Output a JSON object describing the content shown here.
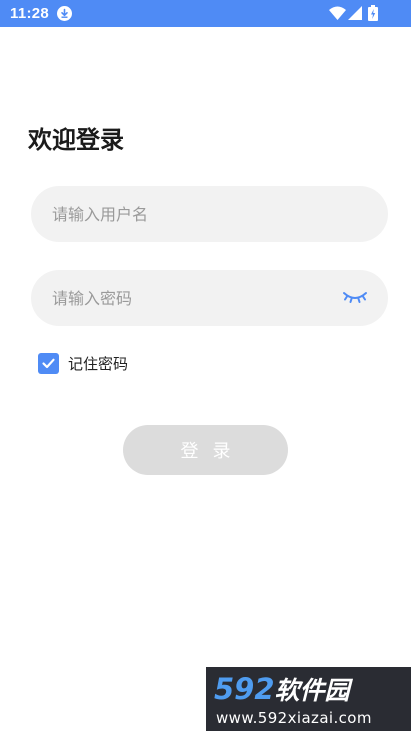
{
  "status_bar": {
    "time": "11:28",
    "background": "#4f8bf5",
    "icons": [
      "download-icon",
      "wifi-icon",
      "signal-icon",
      "battery-icon"
    ]
  },
  "title": "欢迎登录",
  "username": {
    "placeholder": "请输入用户名",
    "value": ""
  },
  "password": {
    "placeholder": "请输入密码",
    "value": "",
    "toggle_icon": "eye-closed-icon"
  },
  "remember": {
    "label": "记住密码",
    "checked": true
  },
  "login_button": {
    "label": "登录",
    "enabled": false
  },
  "watermark": {
    "brand_number": "592",
    "brand_text": "软件园",
    "url": "www.592xiazai.com"
  },
  "colors": {
    "accent": "#4f8bf5",
    "field_bg": "#f2f2f2",
    "button_disabled": "#dcdcdc"
  }
}
